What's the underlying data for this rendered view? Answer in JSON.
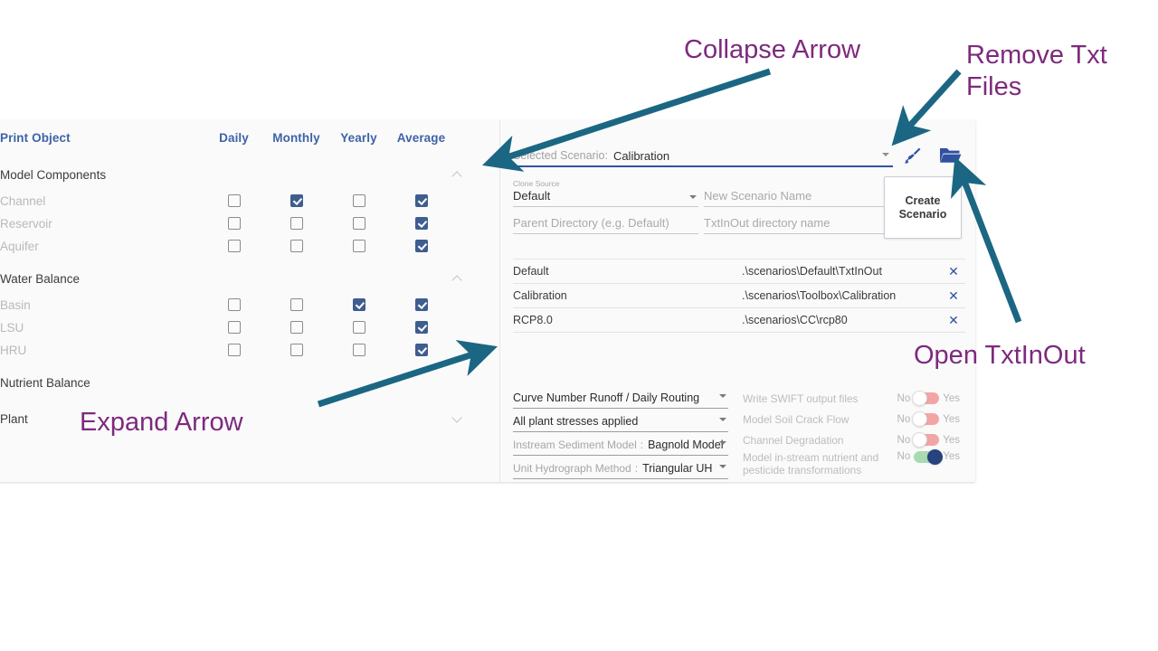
{
  "print_table": {
    "columns": [
      "Print Object",
      "Daily",
      "Monthly",
      "Yearly",
      "Average"
    ],
    "groups": [
      {
        "name": "Model Components",
        "chevron": "chevron-up-icon",
        "rows": [
          {
            "label": "Channel",
            "daily": false,
            "monthly": true,
            "yearly": false,
            "average": true
          },
          {
            "label": "Reservoir",
            "daily": false,
            "monthly": false,
            "yearly": false,
            "average": true
          },
          {
            "label": "Aquifer",
            "daily": false,
            "monthly": false,
            "yearly": false,
            "average": true
          }
        ]
      },
      {
        "name": "Water Balance",
        "chevron": "chevron-up-icon",
        "rows": [
          {
            "label": "Basin",
            "daily": false,
            "monthly": false,
            "yearly": true,
            "average": true
          },
          {
            "label": "LSU",
            "daily": false,
            "monthly": false,
            "yearly": false,
            "average": true
          },
          {
            "label": "HRU",
            "daily": false,
            "monthly": false,
            "yearly": false,
            "average": true
          }
        ]
      },
      {
        "name": "Nutrient Balance",
        "chevron": "",
        "rows": []
      },
      {
        "name": "Plant",
        "chevron": "chevron-down-icon",
        "rows": []
      }
    ]
  },
  "scenario": {
    "label": "Selected Scenario:",
    "value": "Calibration",
    "dropdown_icon": "chevron-down-icon",
    "brush_icon": "brush-icon",
    "folder_icon": "folder-open-icon"
  },
  "clone": {
    "clone_source_label": "Clone Source",
    "clone_source_value": "Default",
    "new_scenario_placeholder": "New Scenario Name",
    "parent_directory_placeholder": "Parent Directory (e.g. Default)",
    "txtinout_placeholder": "TxtInOut directory name",
    "create_button": "Create\nScenario"
  },
  "scenarios_list": [
    {
      "name": "Default",
      "path": ".\\scenarios\\Default\\TxtInOut",
      "remove": "✕"
    },
    {
      "name": "Calibration",
      "path": ".\\scenarios\\Toolbox\\Calibration",
      "remove": "✕"
    },
    {
      "name": "RCP8.0",
      "path": ".\\scenarios\\CC\\rcp80",
      "remove": "✕"
    }
  ],
  "options": [
    {
      "label": "",
      "sep": "",
      "value": "Curve Number Runoff / Daily Routing"
    },
    {
      "label": "",
      "sep": "",
      "value": "All plant stresses applied"
    },
    {
      "label": "Instream Sediment Model",
      "sep": ":",
      "value": "Bagnold Model"
    },
    {
      "label": "Unit Hydrograph Method",
      "sep": ":",
      "value": "Triangular UH"
    }
  ],
  "toggles": {
    "no_label": "No",
    "yes_label": "Yes",
    "items": [
      {
        "label": "Write SWIFT output files",
        "on": false
      },
      {
        "label": "Model Soil Crack Flow",
        "on": false
      },
      {
        "label": "Channel Degradation",
        "on": false
      },
      {
        "label": "Model in-stream nutrient and pesticide transformations",
        "on": true
      }
    ]
  },
  "annotations": {
    "collapse_arrow": "Collapse Arrow",
    "remove_txt_files": "Remove Txt\nFiles",
    "open_txtinout": "Open TxtInOut",
    "expand_arrow": "Expand Arrow"
  },
  "colors": {
    "annotation": "#7d2a7d",
    "arrow": "#1b6683",
    "checkbox_checked": "#3f5d8f",
    "header_blue": "#3f63a8",
    "icon_blue": "#2f51a0",
    "toggle_off": "#f3a5a5",
    "toggle_on": "#a8dcb0",
    "toggle_on_knob": "#26437f"
  }
}
